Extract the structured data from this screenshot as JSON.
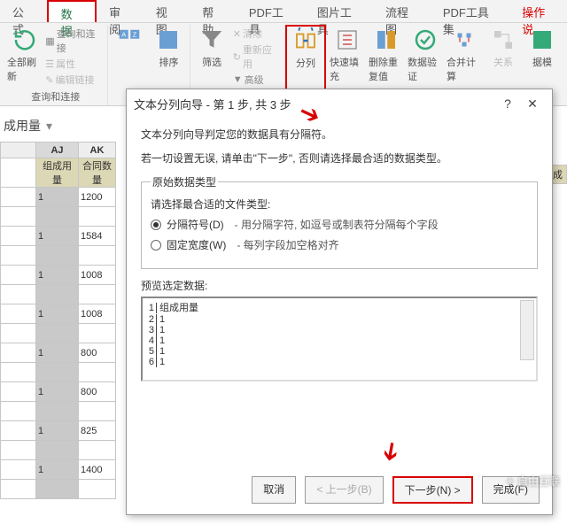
{
  "tabs": {
    "formula": "公式",
    "data": "数据",
    "review": "审阅",
    "view": "视图",
    "help": "帮助",
    "pdf": "PDF工具",
    "pic": "图片工具",
    "flow": "流程图",
    "pdfset": "PDF工具集",
    "tip": "操作说"
  },
  "ribbon": {
    "queries": {
      "label": "查询和连接",
      "refresh": "全部刷新",
      "q": "查询和连接",
      "prop": "属性",
      "edit": "编辑链接"
    },
    "sort": {
      "label": "排序",
      "za": "Z↓A",
      "az": "A↓Z"
    },
    "filter": {
      "label": "筛选",
      "clear": "清除",
      "reapply": "重新应用",
      "adv": "高级"
    },
    "split": {
      "label": "分列"
    },
    "flash": {
      "label": "快速填充"
    },
    "dedup": {
      "label": "删除重复值"
    },
    "valid": {
      "label": "数据验证"
    },
    "consol": {
      "label": "合并计算"
    },
    "relate": {
      "label": "关系"
    },
    "model": {
      "label": "据模"
    }
  },
  "banner": {
    "title": "成用量"
  },
  "grid": {
    "col_aj": "AJ",
    "col_ak": "AK",
    "h1": "组成用量",
    "h2": "合同数量",
    "rows": [
      {
        "a": "1",
        "b": "1200"
      },
      {
        "a": "1",
        "b": "1584"
      },
      {
        "a": "1",
        "b": "1008"
      },
      {
        "a": "1",
        "b": "1008"
      },
      {
        "a": "1",
        "b": "800"
      },
      {
        "a": "1",
        "b": "800"
      },
      {
        "a": "1",
        "b": "825"
      },
      {
        "a": "1",
        "b": "1400"
      }
    ]
  },
  "dialog": {
    "title": "文本分列向导 - 第 1 步, 共 3 步",
    "line1": "文本分列向导判定您的数据具有分隔符。",
    "line2": "若一切设置无误, 请单击\"下一步\", 否则请选择最合适的数据类型。",
    "fs_legend": "原始数据类型",
    "choose": "请选择最合适的文件类型:",
    "r1": "分隔符号(D)",
    "r1d": "- 用分隔字符, 如逗号或制表符分隔每个字段",
    "r2": "固定宽度(W)",
    "r2d": "- 每列字段加空格对齐",
    "preview": "预览选定数据:",
    "plines": [
      "组成用量",
      "1",
      "1",
      "1",
      "1",
      "1"
    ],
    "btn_cancel": "取消",
    "btn_back": "< 上一步(B)",
    "btn_next": "下一步(N) >",
    "btn_finish": "完成(F)"
  },
  "right_header": "辅料成"
}
